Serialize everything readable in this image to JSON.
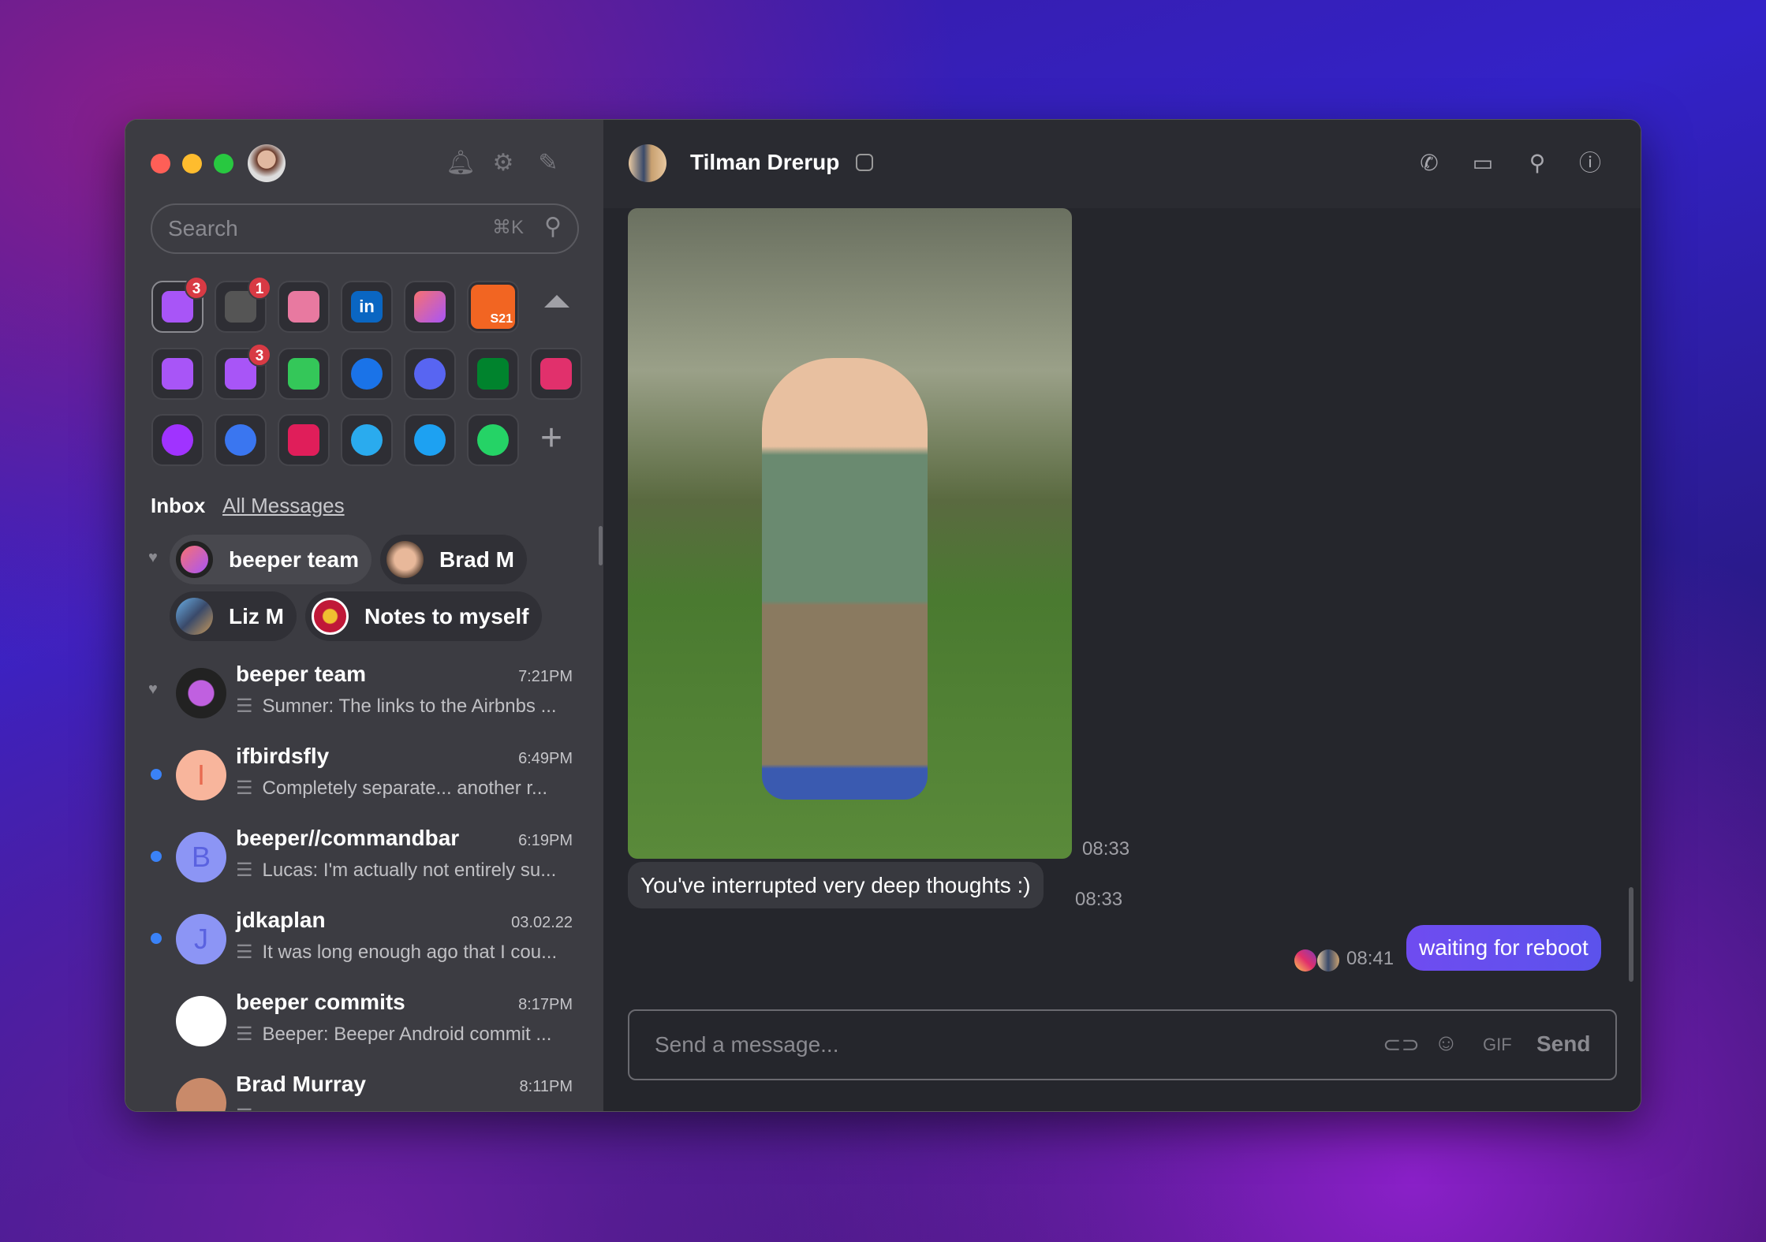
{
  "sidebar": {
    "search_placeholder": "Search",
    "search_shortcut": "⌘K",
    "icons": [
      "bell-icon",
      "gear-icon",
      "compose-icon"
    ],
    "apps": [
      {
        "name": "all-chats",
        "badge": "3",
        "color": "#a855f7"
      },
      {
        "name": "low-priority",
        "badge": "1",
        "color": "#555"
      },
      {
        "name": "bookmarks",
        "color": "#e879a0"
      },
      {
        "name": "linkedin",
        "label": "in",
        "color": "#0a66c2"
      },
      {
        "name": "beeper-slack",
        "color": "#fff"
      },
      {
        "name": "s21",
        "label": "S21",
        "color": "#f26522"
      },
      {
        "name": "beeper",
        "color": "#a855f7"
      },
      {
        "name": "beeper-2",
        "badge": "3",
        "color": "#a855f7"
      },
      {
        "name": "imessage",
        "color": "#34c759"
      },
      {
        "name": "google-messages",
        "color": "#1a73e8"
      },
      {
        "name": "discord",
        "color": "#5865f2"
      },
      {
        "name": "google-chat",
        "color": "#00832d"
      },
      {
        "name": "instagram",
        "color": "#e1306c"
      },
      {
        "name": "messenger",
        "color": "#a033ff"
      },
      {
        "name": "signal",
        "color": "#3a76f0"
      },
      {
        "name": "slack",
        "color": "#e01e5a"
      },
      {
        "name": "telegram",
        "color": "#2aabee"
      },
      {
        "name": "twitter",
        "color": "#1da1f2"
      },
      {
        "name": "whatsapp",
        "color": "#25d366"
      }
    ],
    "tabs": {
      "inbox": "Inbox",
      "all": "All Messages"
    },
    "favorites": [
      "beeper team",
      "Brad M",
      "Liz M",
      "Notes to myself"
    ],
    "chats": [
      {
        "name": "beeper team",
        "time": "7:21PM",
        "preview": "Sumner: The links to the Airbnbs ...",
        "pinned": true,
        "initial": "",
        "color": "#222"
      },
      {
        "name": "ifbirdsfly",
        "time": "6:49PM",
        "preview": "Completely separate... another r...",
        "unread": true,
        "initial": "I",
        "color": "#f8b59c"
      },
      {
        "name": "beeper//commandbar",
        "time": "6:19PM",
        "preview": "Lucas: I'm actually not entirely su...",
        "unread": true,
        "initial": "B",
        "color": "#8c95f5"
      },
      {
        "name": "jdkaplan",
        "time": "03.02.22",
        "preview": "It was long enough ago that I cou...",
        "unread": true,
        "initial": "J",
        "color": "#8c95f5"
      },
      {
        "name": "beeper commits",
        "time": "8:17PM",
        "preview": "Beeper: Beeper Android commit ...",
        "initial": "",
        "color": "#fff"
      },
      {
        "name": "Brad Murray",
        "time": "8:11PM",
        "preview": "",
        "initial": "",
        "color": "#c98a6a"
      }
    ]
  },
  "chat": {
    "title": "Tilman Drerup",
    "messages": [
      {
        "type": "image",
        "time": "08:33"
      },
      {
        "type": "text",
        "text": "You've interrupted very deep thoughts :)",
        "time": "08:33"
      },
      {
        "type": "outgoing",
        "text": "waiting for reboot",
        "time": "08:41"
      }
    ],
    "composer": {
      "placeholder": "Send a message...",
      "gif": "GIF",
      "send": "Send"
    }
  },
  "colors": {
    "accent": "#6a4ff0",
    "unread": "#3a82f7",
    "badge": "#d83a44"
  }
}
